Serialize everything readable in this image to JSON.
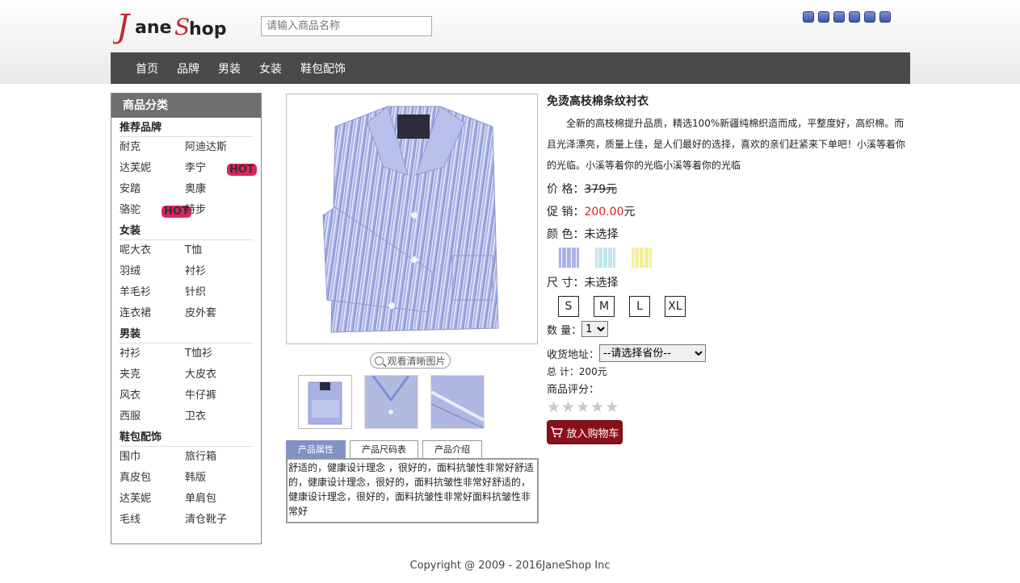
{
  "header": {
    "logo_text_j": "J",
    "logo_text_ane": "ane",
    "logo_text_s": "S",
    "logo_text_hop": "hop",
    "search_placeholder": "请输入商品名称",
    "mini_icon_count": 6
  },
  "nav": {
    "items": [
      "首页",
      "品牌",
      "男装",
      "女装",
      "鞋包配饰"
    ]
  },
  "sidebar": {
    "title": "商品分类",
    "categories": [
      {
        "title": "推荐品牌",
        "items": [
          {
            "label": "耐克",
            "hot": false
          },
          {
            "label": "阿迪达斯",
            "hot": true
          },
          {
            "label": "达芙妮",
            "hot": false
          },
          {
            "label": "李宁",
            "hot": false
          },
          {
            "label": "安踏",
            "hot": false
          },
          {
            "label": "奥康",
            "hot": false
          },
          {
            "label": "骆驼",
            "hot": true
          },
          {
            "label": "特步",
            "hot": false
          }
        ]
      },
      {
        "title": "女装",
        "items": [
          {
            "label": "呢大衣",
            "hot": false
          },
          {
            "label": "T恤",
            "hot": false
          },
          {
            "label": "羽绒",
            "hot": false
          },
          {
            "label": "衬衫",
            "hot": false
          },
          {
            "label": "羊毛衫",
            "hot": false
          },
          {
            "label": "针织",
            "hot": false
          },
          {
            "label": "连衣裙",
            "hot": false
          },
          {
            "label": "皮外套",
            "hot": false
          }
        ]
      },
      {
        "title": "男装",
        "items": [
          {
            "label": "衬衫",
            "hot": false
          },
          {
            "label": "T恤衫",
            "hot": false
          },
          {
            "label": "夹克",
            "hot": false
          },
          {
            "label": "大皮衣",
            "hot": false
          },
          {
            "label": "风衣",
            "hot": false
          },
          {
            "label": "牛仔裤",
            "hot": false
          },
          {
            "label": "西服",
            "hot": false
          },
          {
            "label": "卫衣",
            "hot": false
          }
        ]
      },
      {
        "title": "鞋包配饰",
        "items": [
          {
            "label": "围巾",
            "hot": false
          },
          {
            "label": "旅行箱",
            "hot": false
          },
          {
            "label": "真皮包",
            "hot": false
          },
          {
            "label": "韩版",
            "hot": false
          },
          {
            "label": "达芙妮",
            "hot": false
          },
          {
            "label": "单肩包",
            "hot": false
          },
          {
            "label": "毛线",
            "hot": false
          },
          {
            "label": "清仓靴子",
            "hot": false
          }
        ]
      }
    ],
    "hot_label": "HOT"
  },
  "gallery": {
    "zoom_label": "观看清晰图片"
  },
  "tabs": {
    "labels": [
      "产品属性",
      "产品尺码表",
      "产品介绍"
    ],
    "active": 0,
    "content": "舒适的，健康设计理念 ，很好的，面料抗皱性非常好舒适的，健康设计理念，很好的，面料抗皱性非常好舒适的，健康设计理念，很好的，面料抗皱性非常好面料抗皱性非常好"
  },
  "product": {
    "title": "免烫高枝棉条纹衬衣",
    "description": "全新的高枝棉提升品质，精选100%新疆纯棉织造而成，平整度好，高织棉。而且光泽漂亮，质量上佳，是人们最好的选择，喜欢的亲们赶紧来下单吧！小溪等着你的光临。小溪等着你的光临小溪等着你的光临",
    "price_label": "价 格：",
    "price": "379元",
    "sale_label": "促 销：",
    "sale_price": "200.00",
    "sale_unit": "元",
    "color_label": "颜 色：",
    "color_value": "未选择",
    "swatch_colors": [
      "#a9b3e8",
      "#bfe4ee",
      "#f6ee9a"
    ],
    "size_label": "尺 寸：",
    "size_value": "未选择",
    "sizes": [
      "S",
      "M",
      "L",
      "XL"
    ],
    "qty_label": "数 量：",
    "qty_value": "1",
    "addr_label": "收货地址：",
    "addr_value": "--请选择省份--",
    "total_label": "总 计：",
    "total_value": "200元",
    "rating_label": "商品评分：",
    "rating": 0,
    "rating_max": 5,
    "cart_label": "放入购物车"
  },
  "footer": {
    "text": "Copyright @ 2009 - 2016JaneShop Inc"
  },
  "colors": {
    "nav_bg": "#4a4a4a",
    "accent": "#e02020",
    "cart": "#8a0f1c",
    "tab_active": "#7f93c7"
  }
}
